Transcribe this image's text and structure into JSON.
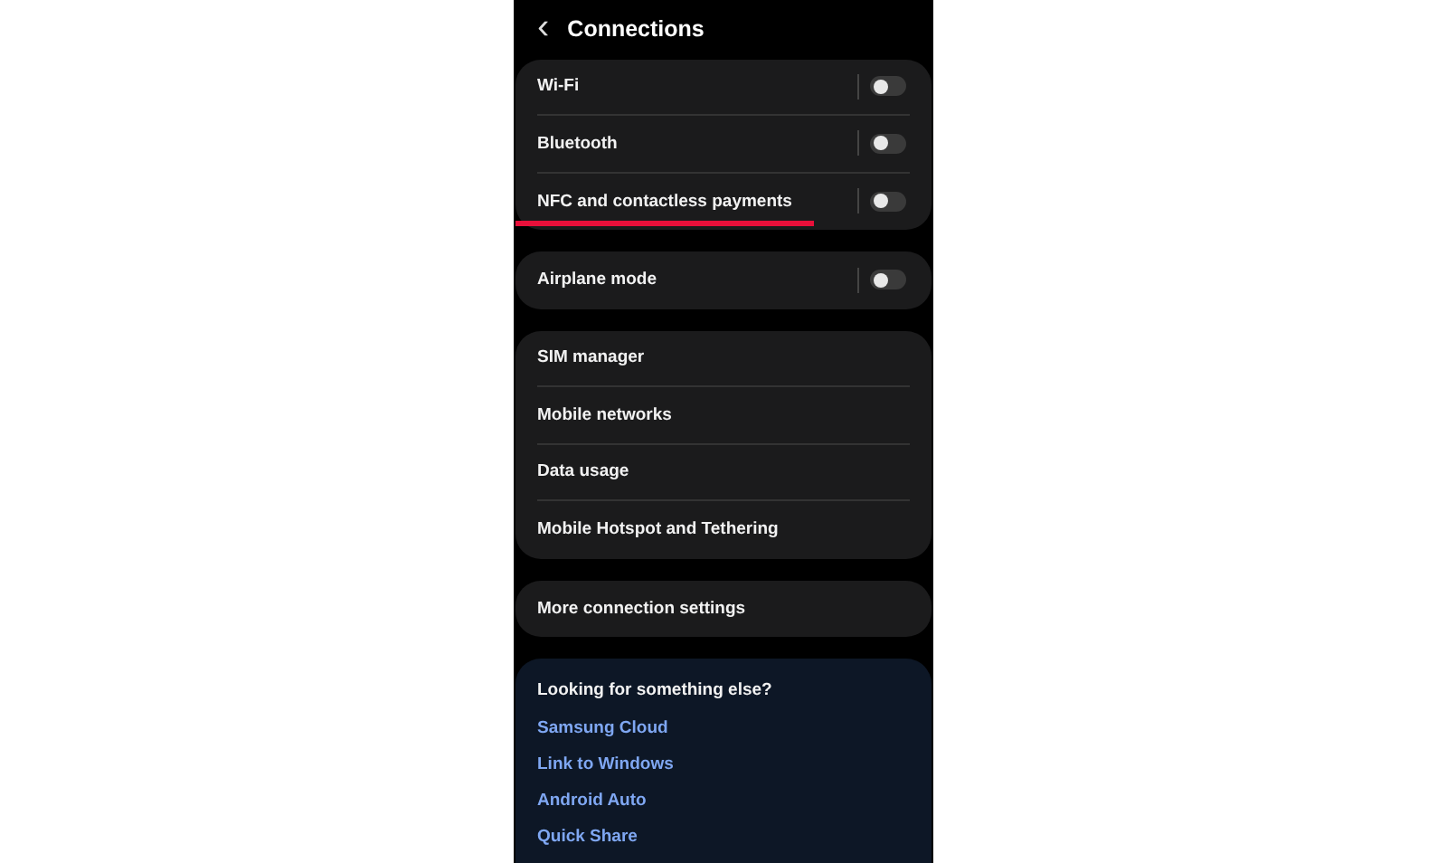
{
  "header": {
    "back": "‹",
    "title": "Connections"
  },
  "groups": [
    {
      "items": [
        {
          "label": "Wi-Fi",
          "kind": "toggle",
          "on": false,
          "underlined": false
        },
        {
          "label": "Bluetooth",
          "kind": "toggle",
          "on": false,
          "underlined": false
        },
        {
          "label": "NFC and contactless payments",
          "kind": "toggle",
          "on": false,
          "underlined": true
        }
      ]
    },
    {
      "items": [
        {
          "label": "Airplane mode",
          "kind": "toggle",
          "on": false,
          "underlined": false
        }
      ]
    },
    {
      "items": [
        {
          "label": "SIM manager",
          "kind": "link",
          "underlined": false
        },
        {
          "label": "Mobile networks",
          "kind": "link",
          "underlined": false
        },
        {
          "label": "Data usage",
          "kind": "link",
          "underlined": false
        },
        {
          "label": "Mobile Hotspot and Tethering",
          "kind": "link",
          "underlined": false
        }
      ]
    },
    {
      "items": [
        {
          "label": "More connection settings",
          "kind": "link",
          "underlined": false
        }
      ]
    }
  ],
  "suggestions": {
    "title": "Looking for something else?",
    "links": [
      "Samsung Cloud",
      "Link to Windows",
      "Android Auto",
      "Quick Share"
    ]
  }
}
